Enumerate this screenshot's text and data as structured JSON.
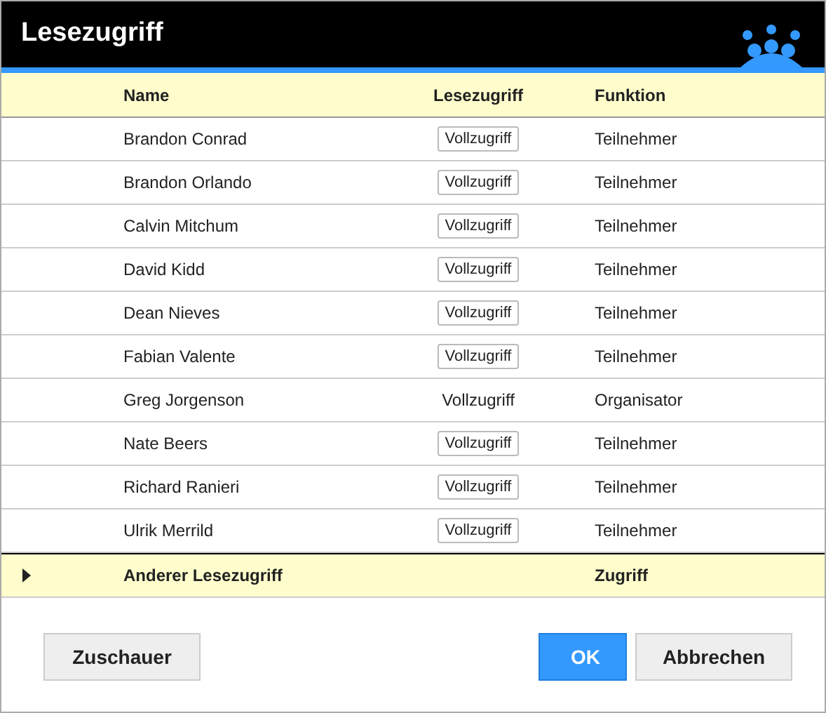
{
  "window": {
    "title": "Lesezugriff"
  },
  "table": {
    "columns": [
      "Name",
      "Lesezugriff",
      "Funktion"
    ],
    "rows": [
      {
        "name": "Brandon Conrad",
        "access": {
          "kind": "button",
          "label": "Vollzugriff"
        },
        "role": "Teilnehmer"
      },
      {
        "name": "Brandon Orlando",
        "access": {
          "kind": "button",
          "label": "Vollzugriff"
        },
        "role": "Teilnehmer"
      },
      {
        "name": "Calvin Mitchum",
        "access": {
          "kind": "button",
          "label": "Vollzugriff"
        },
        "role": "Teilnehmer"
      },
      {
        "name": "David Kidd",
        "access": {
          "kind": "button",
          "label": "Vollzugriff"
        },
        "role": "Teilnehmer"
      },
      {
        "name": "Dean Nieves",
        "access": {
          "kind": "button",
          "label": "Vollzugriff"
        },
        "role": "Teilnehmer"
      },
      {
        "name": "Fabian Valente",
        "access": {
          "kind": "button",
          "label": "Vollzugriff"
        },
        "role": "Teilnehmer"
      },
      {
        "name": "Greg Jorgenson",
        "access": {
          "kind": "text",
          "label": "Vollzugriff"
        },
        "role": "Organisator"
      },
      {
        "name": "Nate Beers",
        "access": {
          "kind": "button",
          "label": "Vollzugriff"
        },
        "role": "Teilnehmer"
      },
      {
        "name": "Richard Ranieri",
        "access": {
          "kind": "button",
          "label": "Vollzugriff"
        },
        "role": "Teilnehmer"
      },
      {
        "name": "Ulrik Merrild",
        "access": {
          "kind": "button",
          "label": "Vollzugriff"
        },
        "role": "Teilnehmer"
      }
    ],
    "group": {
      "label": "Anderer Lesezugriff",
      "column_3": "Zugriff",
      "expanded": false
    }
  },
  "buttons": {
    "left": "Zuschauer",
    "ok": "OK",
    "cancel": "Abbrechen"
  }
}
